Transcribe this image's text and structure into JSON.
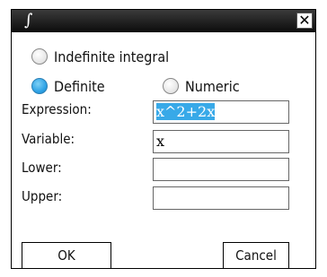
{
  "dialog": {
    "title_glyph": "∫",
    "close_glyph": "✕"
  },
  "options": {
    "indefinite_label": "Indefinite integral",
    "definite_label": "Definite",
    "numeric_label": "Numeric",
    "selected": "Definite"
  },
  "fields": {
    "expression_label": "Expression:",
    "expression_value": "x^2+2x",
    "variable_label": "Variable:",
    "variable_value": "x",
    "lower_label": "Lower:",
    "lower_value": "",
    "upper_label": "Upper:",
    "upper_value": ""
  },
  "buttons": {
    "ok_label": "OK",
    "cancel_label": "Cancel"
  },
  "colors": {
    "selection": "#38a9e8",
    "title_bar": "#1a1a1a"
  }
}
